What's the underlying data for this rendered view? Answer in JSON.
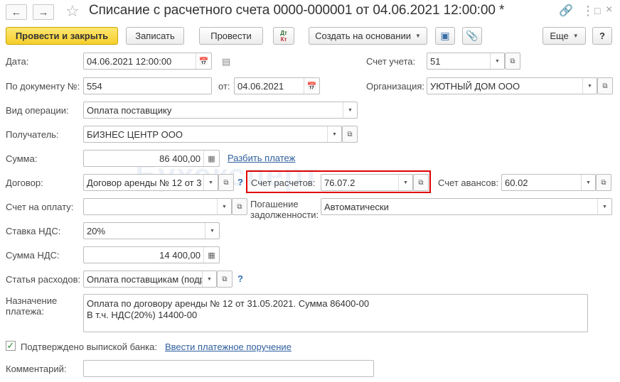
{
  "window": {
    "title": "Списание с расчетного счета 0000-000001 от 04.06.2021 12:00:00 *",
    "back_icon": "arrow-left-icon",
    "forward_icon": "arrow-right-icon",
    "link_icon": "link-icon",
    "more_icon": "kebab-icon",
    "maximize_icon": "maximize-icon",
    "close_icon": "close-icon"
  },
  "toolbar": {
    "post_close": "Провести и закрыть",
    "write": "Записать",
    "post": "Провести",
    "dt_kt_top": "Дт",
    "dt_kt_bottom": "Кт",
    "create_based": "Создать на основании",
    "more": "Еще",
    "help": "?"
  },
  "form": {
    "date_label": "Дата:",
    "date_value": "04.06.2021 12:00:00",
    "account_label": "Счет учета:",
    "account_value": "51",
    "doc_no_label": "По документу №:",
    "doc_no_value": "554",
    "from_label": "от:",
    "from_value": "04.06.2021",
    "org_label": "Организация:",
    "org_value": "УЮТНЫЙ ДОМ ООО",
    "op_type_label": "Вид операции:",
    "op_type_value": "Оплата поставщику",
    "recipient_label": "Получатель:",
    "recipient_value": "БИЗНЕС ЦЕНТР ООО",
    "sum_label": "Сумма:",
    "sum_value": "86 400,00",
    "split_link": "Разбить платеж",
    "contract_label": "Договор:",
    "contract_value": "Договор аренды № 12 от 3",
    "settle_label": "Счет расчетов:",
    "settle_value": "76.07.2",
    "advance_label": "Счет авансов:",
    "advance_value": "60.02",
    "invoice_label": "Счет на оплату:",
    "invoice_value": "",
    "repay_label_1": "Погашение",
    "repay_label_2": "задолженности:",
    "repay_value": "Автоматически",
    "vat_rate_label": "Ставка НДС:",
    "vat_rate_value": "20%",
    "vat_sum_label": "Сумма НДС:",
    "vat_sum_value": "14 400,00",
    "expense_label": "Статья расходов:",
    "expense_value": "Оплата поставщикам (подр",
    "purpose_label_1": "Назначение",
    "purpose_label_2": "платежа:",
    "purpose_line_1": "Оплата по договору аренды № 12 от 31.05.2021. Сумма 86400-00",
    "purpose_line_2": "В т.ч. НДС(20%) 14400-00",
    "confirmed_label": "Подтверждено выпиской банка:",
    "enter_order_link": "Ввести платежное поручение",
    "comment_label": "Комментарий:",
    "comment_value": "",
    "help_mark": "?"
  },
  "watermark": "Бухэксперт"
}
